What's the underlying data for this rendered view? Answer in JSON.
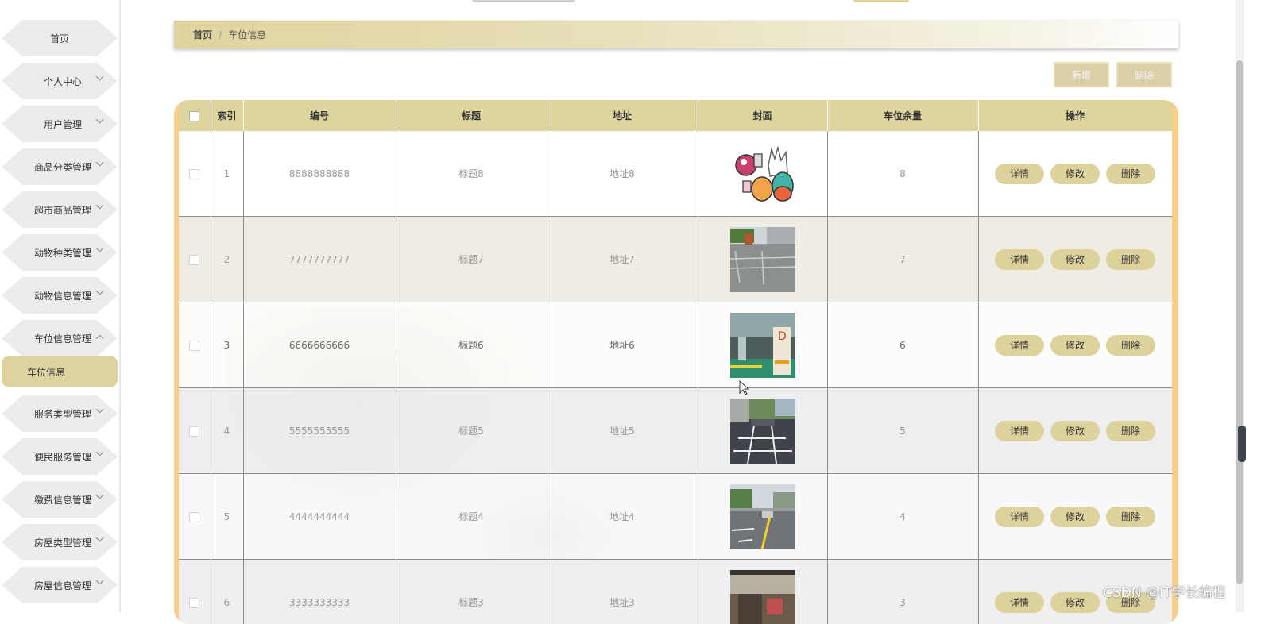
{
  "sidebar": {
    "items": [
      {
        "label": "首页",
        "expandable": false
      },
      {
        "label": "个人中心",
        "expandable": true
      },
      {
        "label": "用户管理",
        "expandable": true
      },
      {
        "label": "商品分类管理",
        "expandable": true
      },
      {
        "label": "超市商品管理",
        "expandable": true
      },
      {
        "label": "动物种类管理",
        "expandable": true
      },
      {
        "label": "动物信息管理",
        "expandable": true
      },
      {
        "label": "车位信息管理",
        "expandable": true,
        "expanded": true
      },
      {
        "label": "服务类型管理",
        "expandable": true
      },
      {
        "label": "便民服务管理",
        "expandable": true
      },
      {
        "label": "缴费信息管理",
        "expandable": true
      },
      {
        "label": "房屋类型管理",
        "expandable": true
      },
      {
        "label": "房屋信息管理",
        "expandable": true
      }
    ],
    "active_subitem": "车位信息"
  },
  "breadcrumb": {
    "home": "首页",
    "separator": "/",
    "current": "车位信息"
  },
  "actions": {
    "add_label": "新增",
    "delete_label": "删除"
  },
  "table": {
    "headers": [
      "索引",
      "编号",
      "标题",
      "地址",
      "封面",
      "车位余量",
      "操作"
    ],
    "rows": [
      {
        "index": "1",
        "code": "8888888888",
        "title": "标题8",
        "address": "地址8",
        "cover": "cartoon-illustration",
        "remaining": "8"
      },
      {
        "index": "2",
        "code": "7777777777",
        "title": "标题7",
        "address": "地址7",
        "cover": "paved-parking-lot",
        "remaining": "7"
      },
      {
        "index": "3",
        "code": "6666666666",
        "title": "标题6",
        "address": "地址6",
        "cover": "underground-garage",
        "remaining": "6"
      },
      {
        "index": "4",
        "code": "5555555555",
        "title": "标题5",
        "address": "地址5",
        "cover": "street-parking",
        "remaining": "5"
      },
      {
        "index": "5",
        "code": "4444444444",
        "title": "标题4",
        "address": "地址4",
        "cover": "parking-lot-yellow-lines",
        "remaining": "4"
      },
      {
        "index": "6",
        "code": "3333333333",
        "title": "标题3",
        "address": "地址3",
        "cover": "building-entrance",
        "remaining": "3"
      }
    ],
    "row_actions": {
      "detail": "详情",
      "edit": "修改",
      "delete": "删除"
    }
  },
  "watermark": "CSDN @IT学长编程",
  "colors": {
    "accent": "#ded49e",
    "table_frame": "#f6cf8a",
    "sidebar_item": "#ececec"
  }
}
